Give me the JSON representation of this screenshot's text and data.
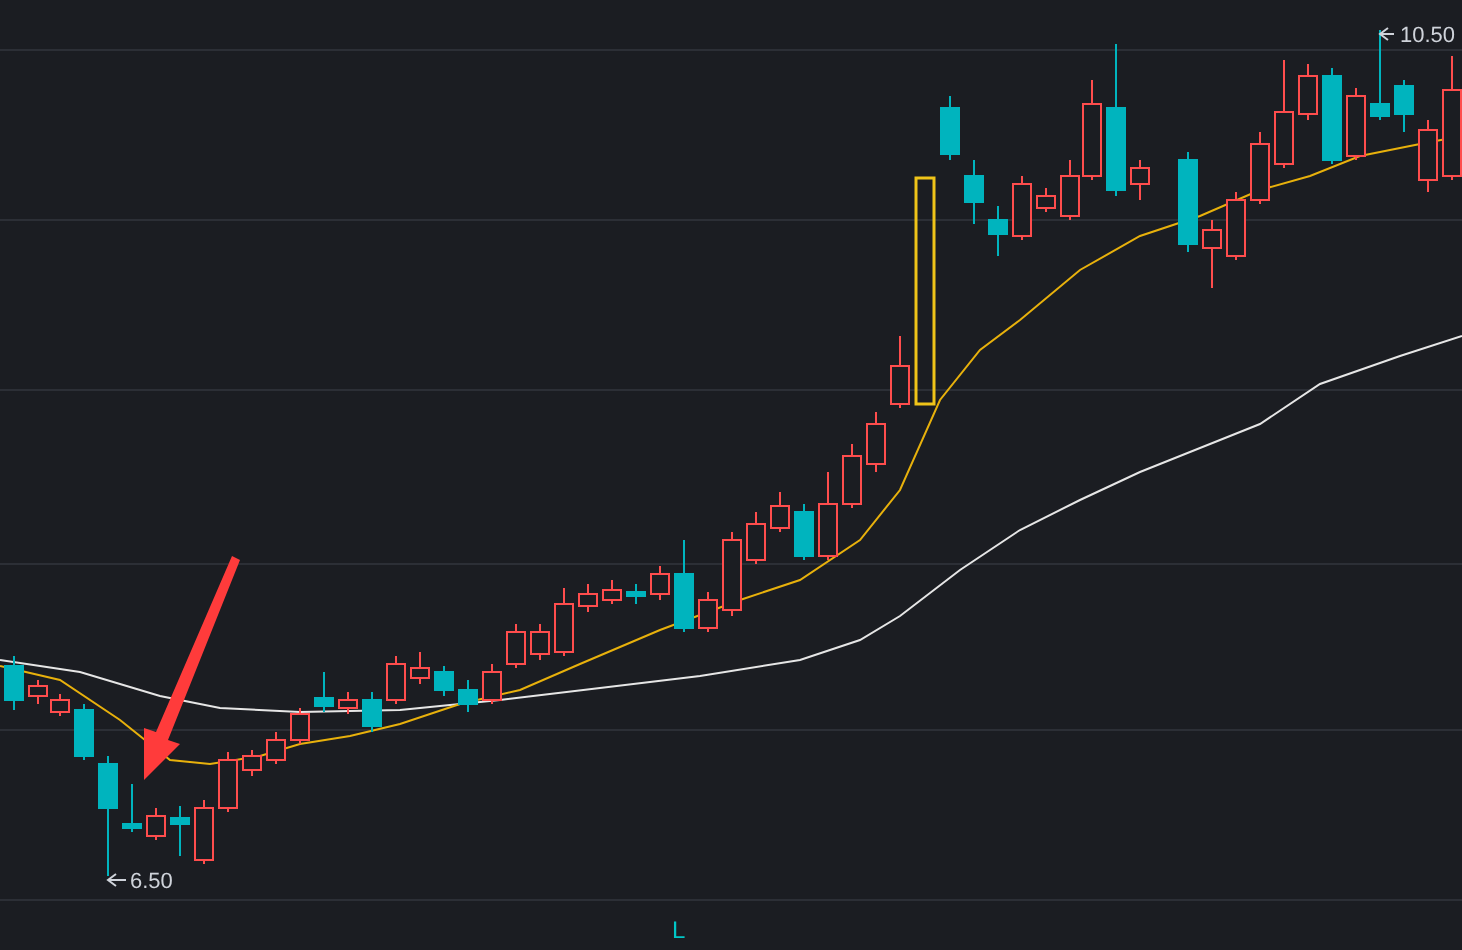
{
  "chart": {
    "high_label": "10.50",
    "low_label": "6.50",
    "marker": "L"
  }
}
